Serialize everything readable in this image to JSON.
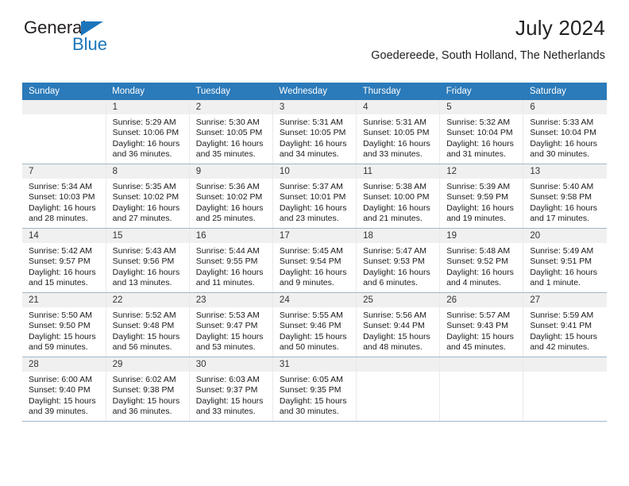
{
  "brand": {
    "name_top": "General",
    "name_bottom": "Blue",
    "accent_color": "#1b75bb"
  },
  "header": {
    "title": "July 2024",
    "subtitle": "Goedereede, South Holland, The Netherlands"
  },
  "calendar": {
    "header_color": "#2b7ab9",
    "daynum_background": "#f0f0f0",
    "weekdays": [
      "Sunday",
      "Monday",
      "Tuesday",
      "Wednesday",
      "Thursday",
      "Friday",
      "Saturday"
    ],
    "weeks": [
      [
        {
          "day": "",
          "lines": []
        },
        {
          "day": "1",
          "lines": [
            "Sunrise: 5:29 AM",
            "Sunset: 10:06 PM",
            "Daylight: 16 hours",
            "and 36 minutes."
          ]
        },
        {
          "day": "2",
          "lines": [
            "Sunrise: 5:30 AM",
            "Sunset: 10:05 PM",
            "Daylight: 16 hours",
            "and 35 minutes."
          ]
        },
        {
          "day": "3",
          "lines": [
            "Sunrise: 5:31 AM",
            "Sunset: 10:05 PM",
            "Daylight: 16 hours",
            "and 34 minutes."
          ]
        },
        {
          "day": "4",
          "lines": [
            "Sunrise: 5:31 AM",
            "Sunset: 10:05 PM",
            "Daylight: 16 hours",
            "and 33 minutes."
          ]
        },
        {
          "day": "5",
          "lines": [
            "Sunrise: 5:32 AM",
            "Sunset: 10:04 PM",
            "Daylight: 16 hours",
            "and 31 minutes."
          ]
        },
        {
          "day": "6",
          "lines": [
            "Sunrise: 5:33 AM",
            "Sunset: 10:04 PM",
            "Daylight: 16 hours",
            "and 30 minutes."
          ]
        }
      ],
      [
        {
          "day": "7",
          "lines": [
            "Sunrise: 5:34 AM",
            "Sunset: 10:03 PM",
            "Daylight: 16 hours",
            "and 28 minutes."
          ]
        },
        {
          "day": "8",
          "lines": [
            "Sunrise: 5:35 AM",
            "Sunset: 10:02 PM",
            "Daylight: 16 hours",
            "and 27 minutes."
          ]
        },
        {
          "day": "9",
          "lines": [
            "Sunrise: 5:36 AM",
            "Sunset: 10:02 PM",
            "Daylight: 16 hours",
            "and 25 minutes."
          ]
        },
        {
          "day": "10",
          "lines": [
            "Sunrise: 5:37 AM",
            "Sunset: 10:01 PM",
            "Daylight: 16 hours",
            "and 23 minutes."
          ]
        },
        {
          "day": "11",
          "lines": [
            "Sunrise: 5:38 AM",
            "Sunset: 10:00 PM",
            "Daylight: 16 hours",
            "and 21 minutes."
          ]
        },
        {
          "day": "12",
          "lines": [
            "Sunrise: 5:39 AM",
            "Sunset: 9:59 PM",
            "Daylight: 16 hours",
            "and 19 minutes."
          ]
        },
        {
          "day": "13",
          "lines": [
            "Sunrise: 5:40 AM",
            "Sunset: 9:58 PM",
            "Daylight: 16 hours",
            "and 17 minutes."
          ]
        }
      ],
      [
        {
          "day": "14",
          "lines": [
            "Sunrise: 5:42 AM",
            "Sunset: 9:57 PM",
            "Daylight: 16 hours",
            "and 15 minutes."
          ]
        },
        {
          "day": "15",
          "lines": [
            "Sunrise: 5:43 AM",
            "Sunset: 9:56 PM",
            "Daylight: 16 hours",
            "and 13 minutes."
          ]
        },
        {
          "day": "16",
          "lines": [
            "Sunrise: 5:44 AM",
            "Sunset: 9:55 PM",
            "Daylight: 16 hours",
            "and 11 minutes."
          ]
        },
        {
          "day": "17",
          "lines": [
            "Sunrise: 5:45 AM",
            "Sunset: 9:54 PM",
            "Daylight: 16 hours",
            "and 9 minutes."
          ]
        },
        {
          "day": "18",
          "lines": [
            "Sunrise: 5:47 AM",
            "Sunset: 9:53 PM",
            "Daylight: 16 hours",
            "and 6 minutes."
          ]
        },
        {
          "day": "19",
          "lines": [
            "Sunrise: 5:48 AM",
            "Sunset: 9:52 PM",
            "Daylight: 16 hours",
            "and 4 minutes."
          ]
        },
        {
          "day": "20",
          "lines": [
            "Sunrise: 5:49 AM",
            "Sunset: 9:51 PM",
            "Daylight: 16 hours",
            "and 1 minute."
          ]
        }
      ],
      [
        {
          "day": "21",
          "lines": [
            "Sunrise: 5:50 AM",
            "Sunset: 9:50 PM",
            "Daylight: 15 hours",
            "and 59 minutes."
          ]
        },
        {
          "day": "22",
          "lines": [
            "Sunrise: 5:52 AM",
            "Sunset: 9:48 PM",
            "Daylight: 15 hours",
            "and 56 minutes."
          ]
        },
        {
          "day": "23",
          "lines": [
            "Sunrise: 5:53 AM",
            "Sunset: 9:47 PM",
            "Daylight: 15 hours",
            "and 53 minutes."
          ]
        },
        {
          "day": "24",
          "lines": [
            "Sunrise: 5:55 AM",
            "Sunset: 9:46 PM",
            "Daylight: 15 hours",
            "and 50 minutes."
          ]
        },
        {
          "day": "25",
          "lines": [
            "Sunrise: 5:56 AM",
            "Sunset: 9:44 PM",
            "Daylight: 15 hours",
            "and 48 minutes."
          ]
        },
        {
          "day": "26",
          "lines": [
            "Sunrise: 5:57 AM",
            "Sunset: 9:43 PM",
            "Daylight: 15 hours",
            "and 45 minutes."
          ]
        },
        {
          "day": "27",
          "lines": [
            "Sunrise: 5:59 AM",
            "Sunset: 9:41 PM",
            "Daylight: 15 hours",
            "and 42 minutes."
          ]
        }
      ],
      [
        {
          "day": "28",
          "lines": [
            "Sunrise: 6:00 AM",
            "Sunset: 9:40 PM",
            "Daylight: 15 hours",
            "and 39 minutes."
          ]
        },
        {
          "day": "29",
          "lines": [
            "Sunrise: 6:02 AM",
            "Sunset: 9:38 PM",
            "Daylight: 15 hours",
            "and 36 minutes."
          ]
        },
        {
          "day": "30",
          "lines": [
            "Sunrise: 6:03 AM",
            "Sunset: 9:37 PM",
            "Daylight: 15 hours",
            "and 33 minutes."
          ]
        },
        {
          "day": "31",
          "lines": [
            "Sunrise: 6:05 AM",
            "Sunset: 9:35 PM",
            "Daylight: 15 hours",
            "and 30 minutes."
          ]
        },
        {
          "day": "",
          "lines": []
        },
        {
          "day": "",
          "lines": []
        },
        {
          "day": "",
          "lines": []
        }
      ]
    ]
  }
}
